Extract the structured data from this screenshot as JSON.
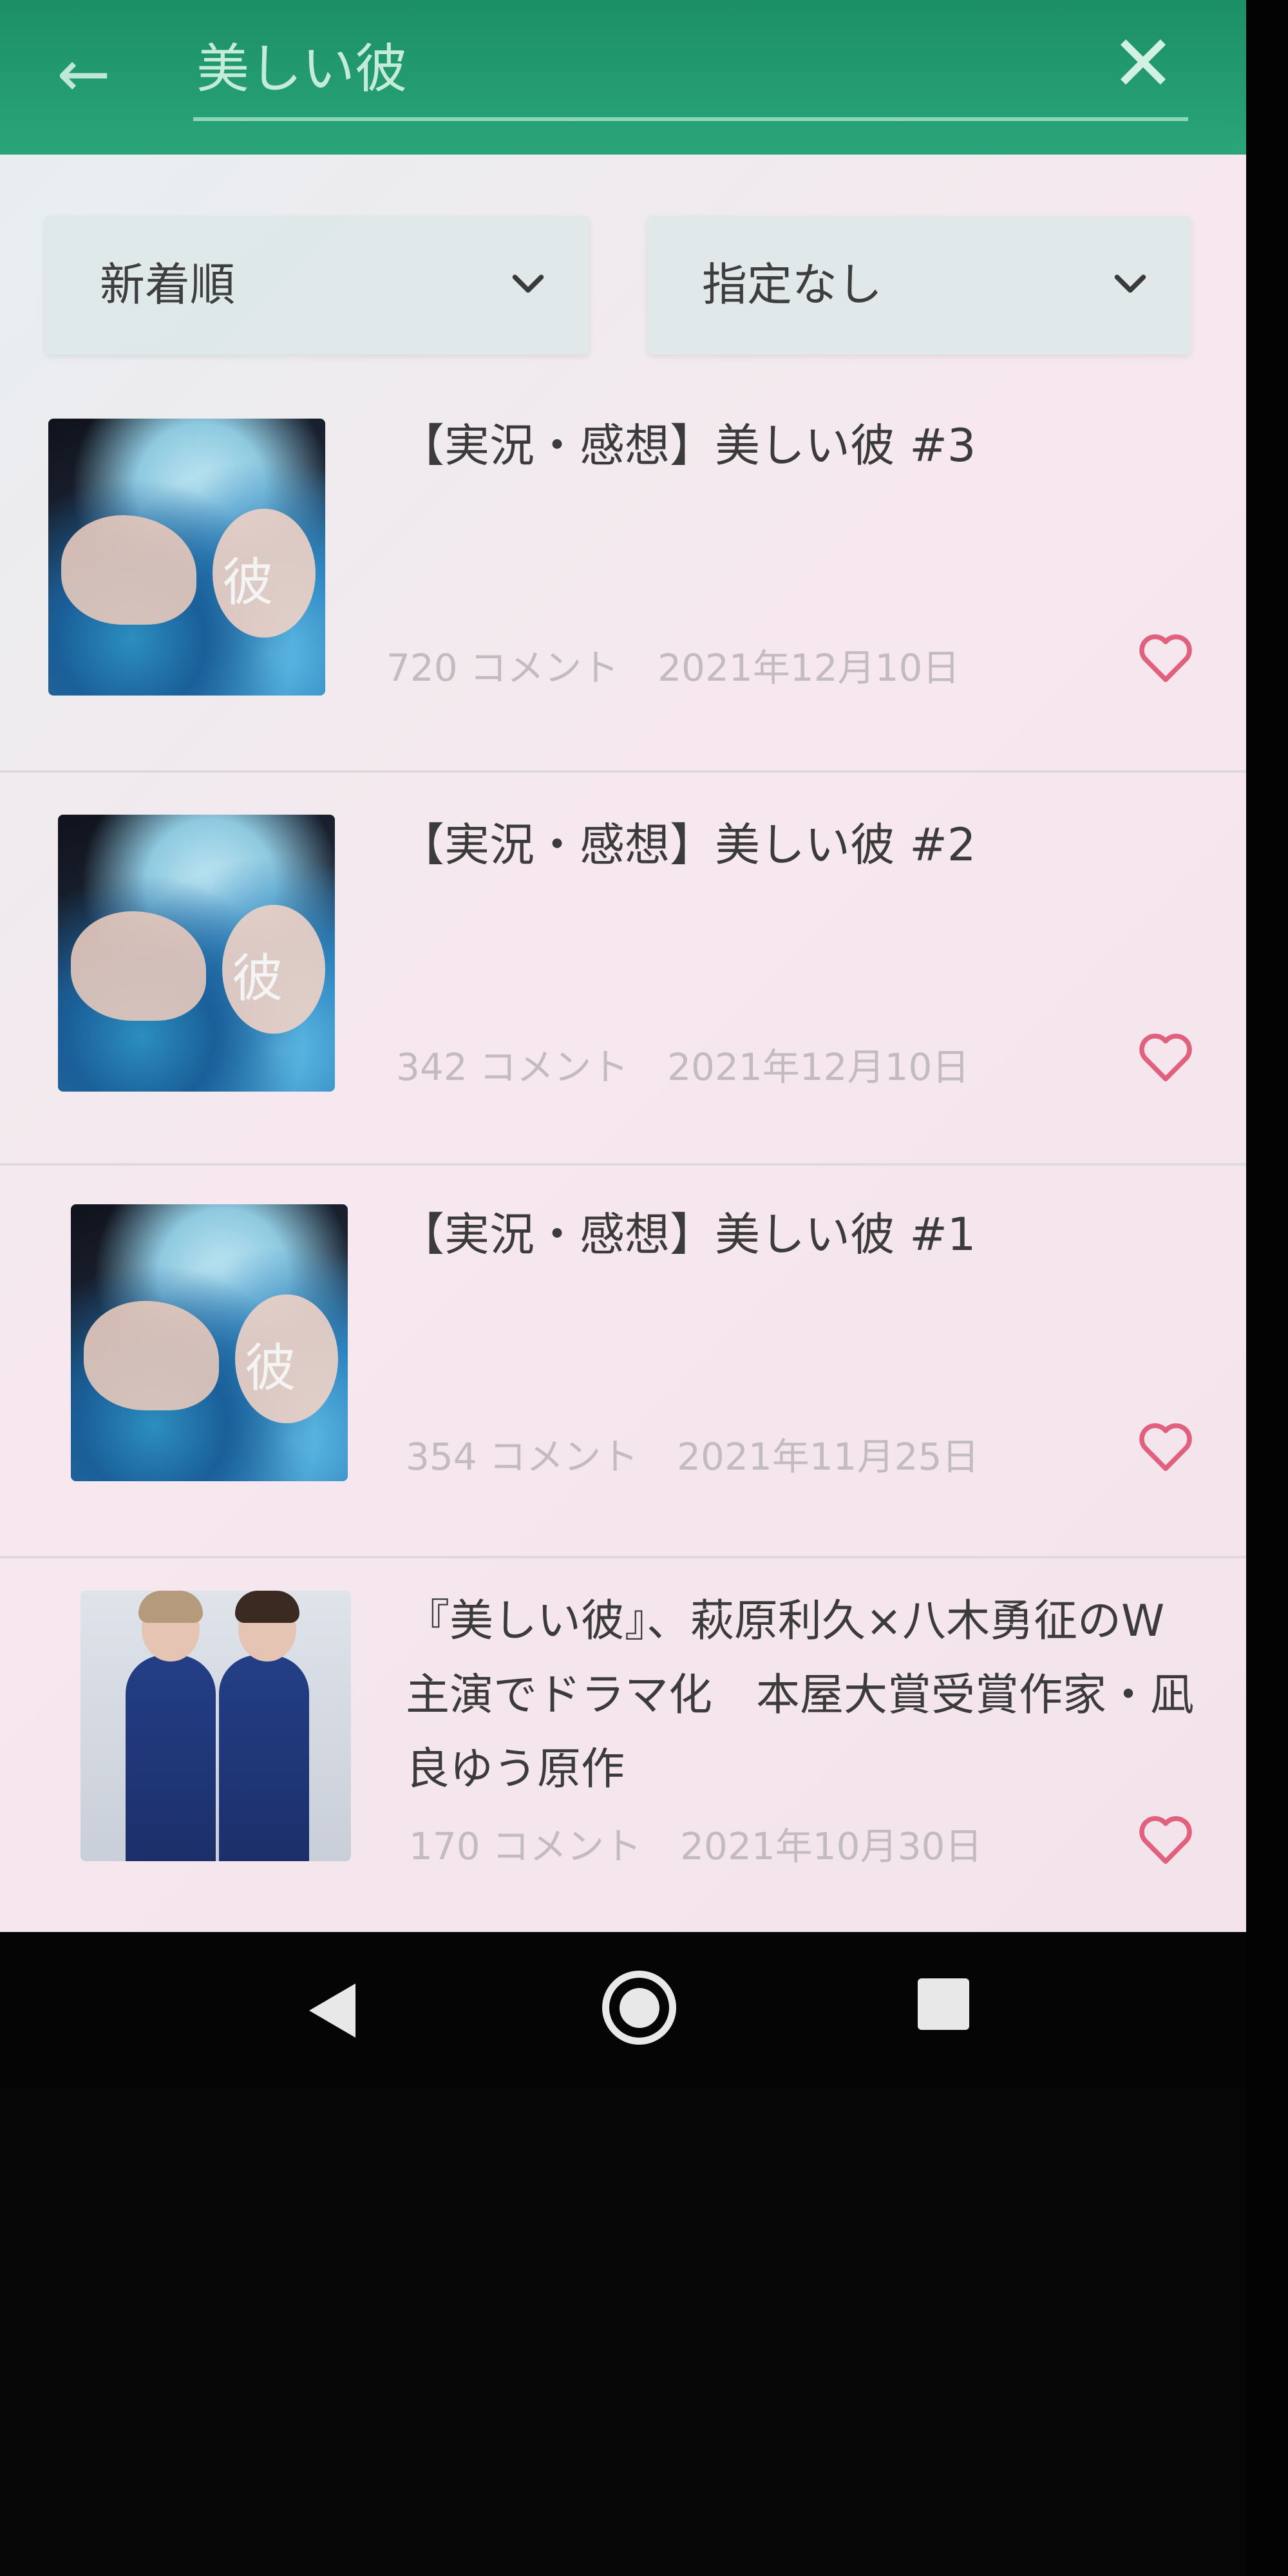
{
  "header": {
    "query": "美しい彼",
    "back_icon": "arrow-left-icon",
    "close_icon": "close-icon"
  },
  "filters": {
    "sort": "新着順",
    "category": "指定なし"
  },
  "items": [
    {
      "title": "【実況・感想】美しい彼 #3",
      "comments": "720 コメント",
      "date": "2021年12月10日",
      "thumb": "cover"
    },
    {
      "title": "【実況・感想】美しい彼 #2",
      "comments": "342 コメント",
      "date": "2021年12月10日",
      "thumb": "cover"
    },
    {
      "title": "【実況・感想】美しい彼 #1",
      "comments": "354 コメント",
      "date": "2021年11月25日",
      "thumb": "cover"
    },
    {
      "title": "『美しい彼』、萩原利久×八木勇征のW主演でドラマ化　本屋大賞受賞作家・凪良ゆう原作",
      "comments": "170 コメント",
      "date": "2021年10月30日",
      "thumb": "photo"
    }
  ],
  "colors": {
    "header_green": "#1f9a6f",
    "heart_pink": "#e0607e"
  }
}
